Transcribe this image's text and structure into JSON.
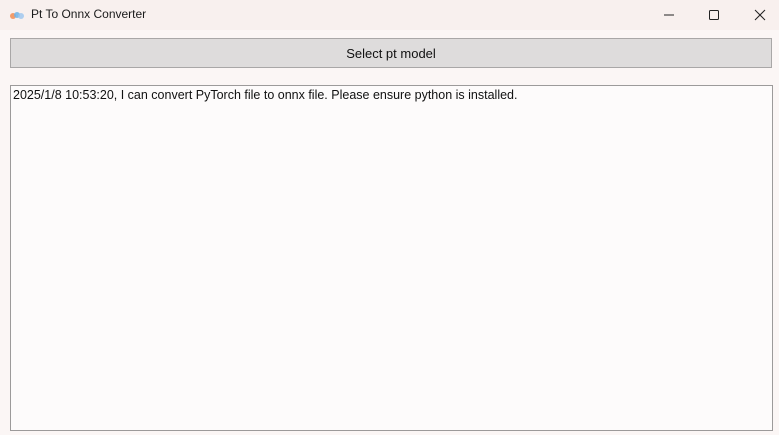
{
  "window": {
    "title": "Pt To Onnx Converter",
    "icon": "app-icon",
    "controls": [
      "minimize-icon",
      "maximize-icon",
      "close-icon"
    ]
  },
  "main": {
    "select_button_label": "Select pt model",
    "log_lines": [
      "2025/1/8 10:53:20, I can convert PyTorch file to onnx file. Please ensure python is installed."
    ]
  },
  "colors": {
    "titlebar_bg": "#f8f0ee",
    "button_bg": "#dedcdc",
    "log_bg": "#fdfbfb"
  }
}
